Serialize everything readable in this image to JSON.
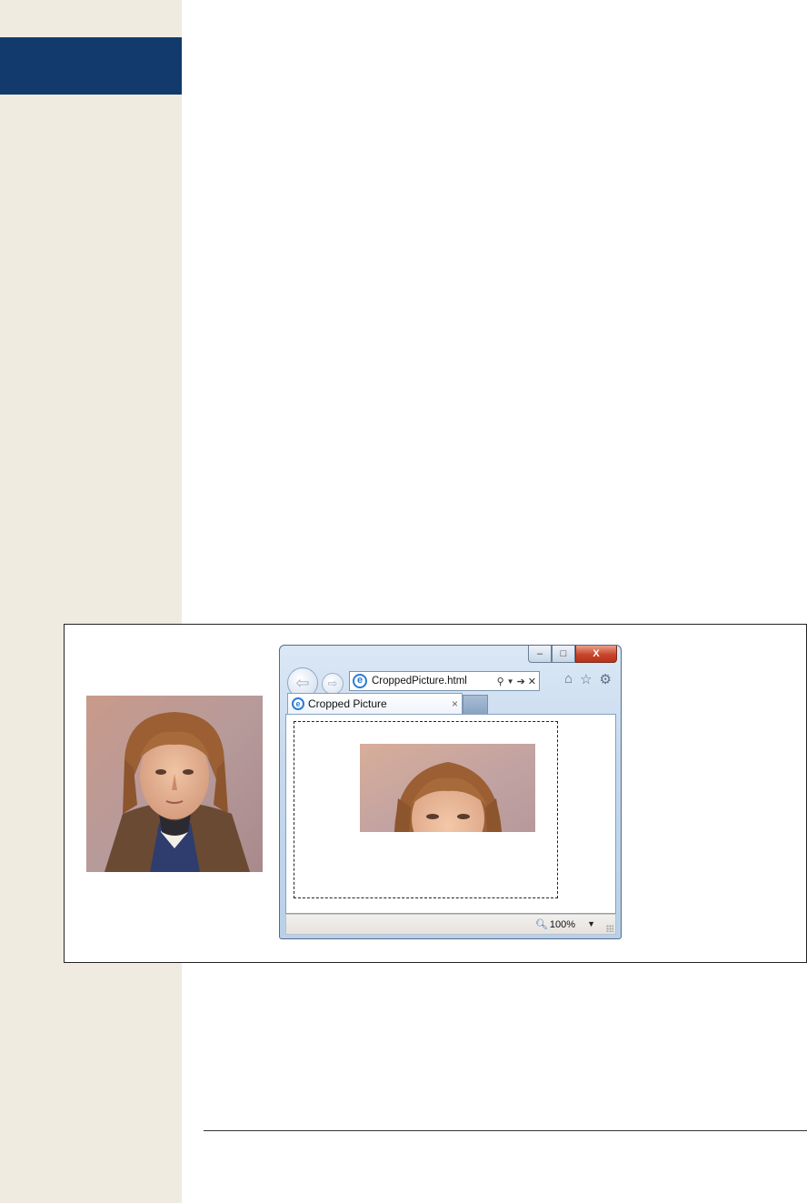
{
  "browser": {
    "address": "CroppedPicture.html",
    "tab_title": "Cropped Picture",
    "tab_close_glyph": "×",
    "zoom_level": "100%",
    "caption": {
      "minimize": "–",
      "maximize": "□",
      "close": "X"
    }
  },
  "icons": {
    "back": "back-arrow-icon",
    "forward": "forward-arrow-icon",
    "ie_logo": "ie-logo-icon",
    "search": "search-icon",
    "go": "go-arrow-icon",
    "stop": "stop-x-icon",
    "home": "home-icon",
    "favorites": "star-icon",
    "tools": "gear-icon",
    "zoom": "magnifier-icon"
  },
  "colors": {
    "sidebar": "#f0ebe1",
    "chapter_tab": "#123a6c",
    "window_chrome": "#c5d9ee",
    "close_button": "#c7452b"
  }
}
